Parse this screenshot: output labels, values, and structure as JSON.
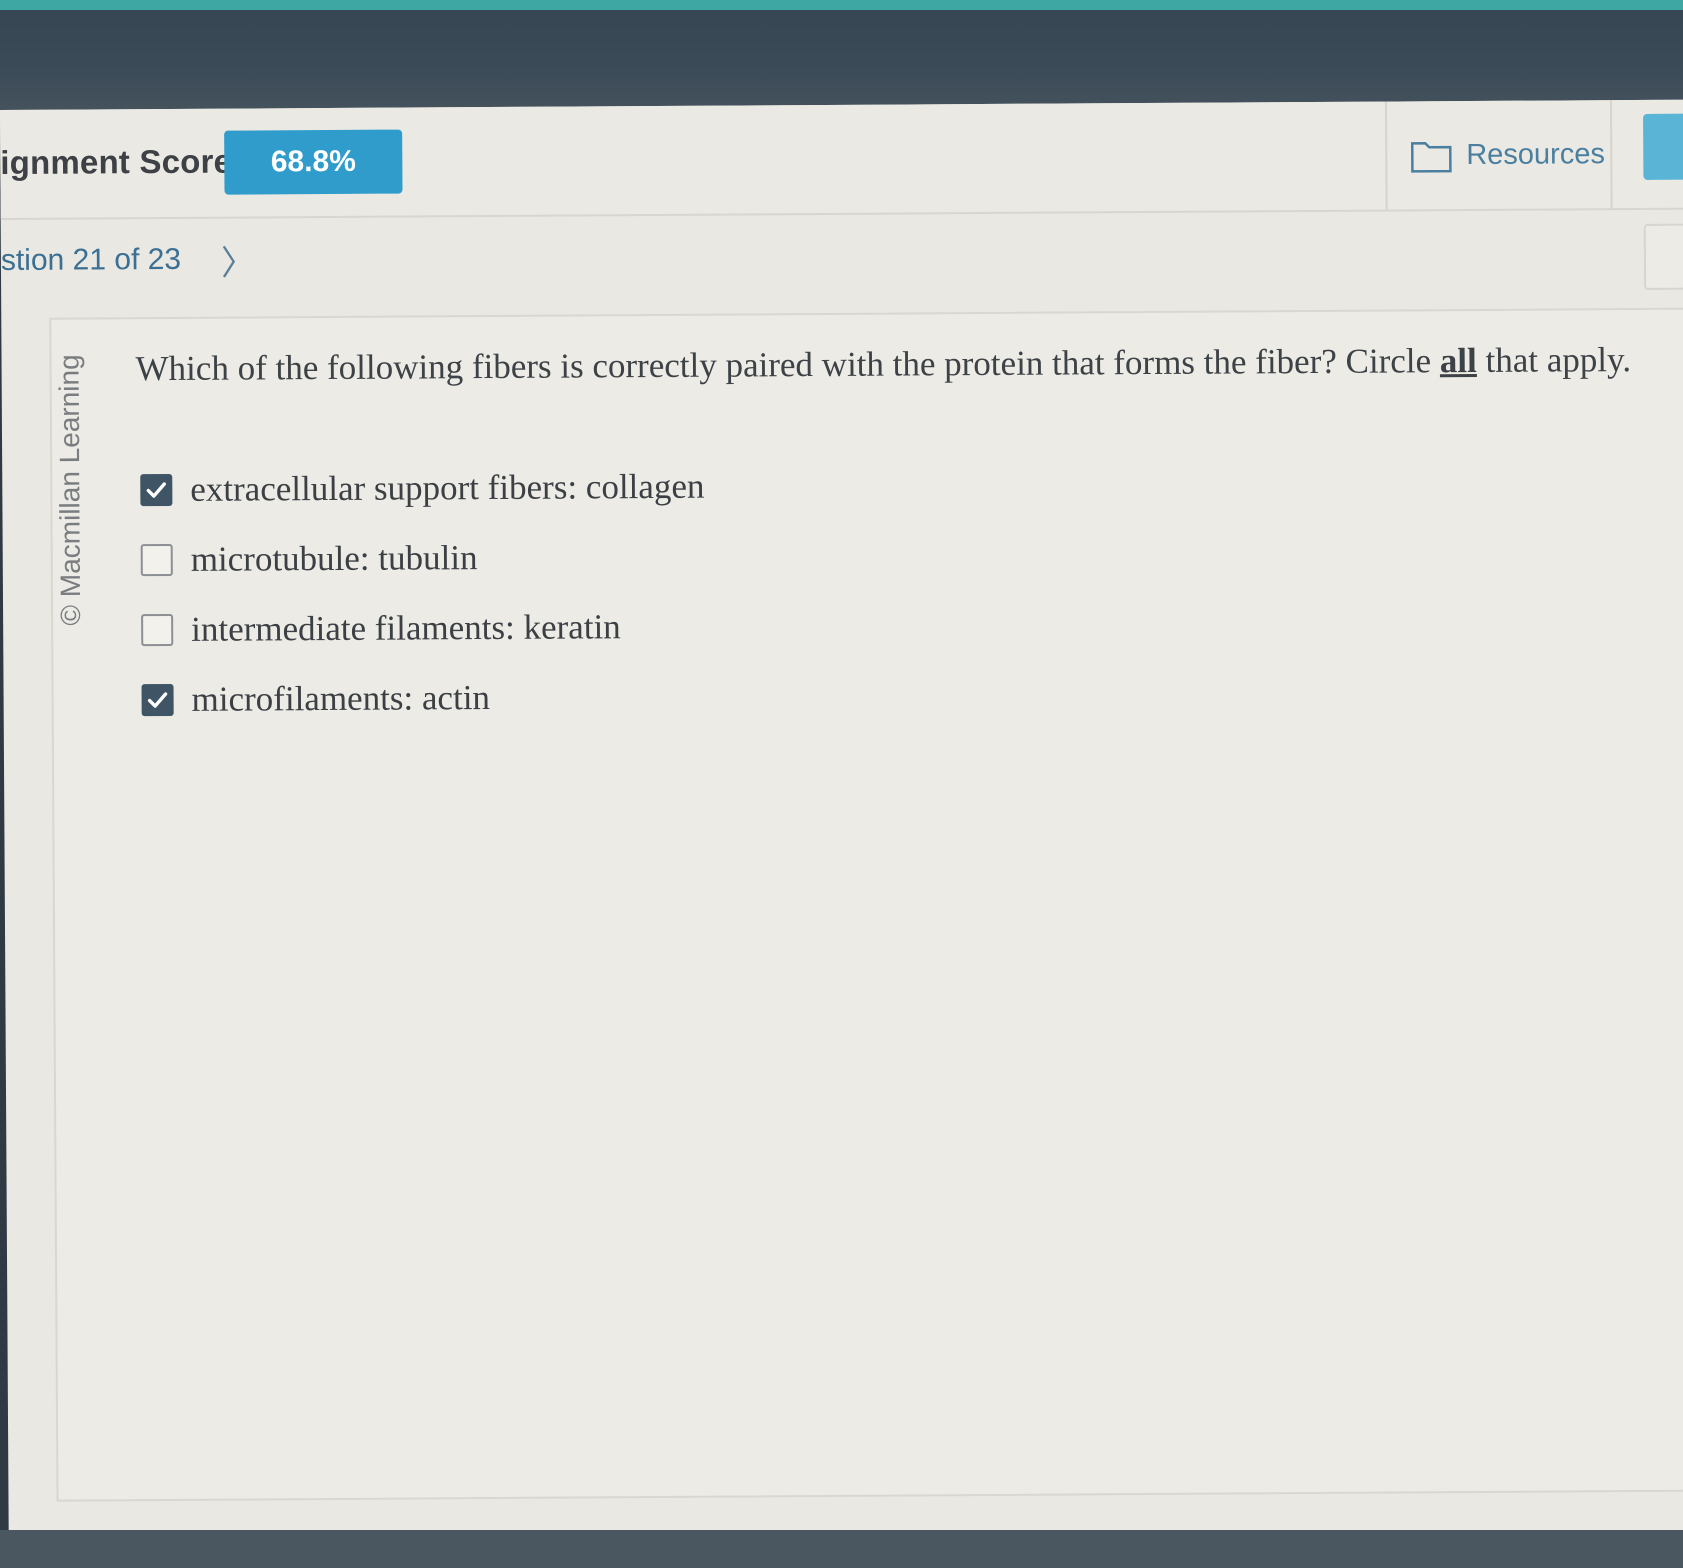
{
  "header": {
    "score_label": "ignment Score:",
    "score_value": "68.8%",
    "resources_label": "Resources"
  },
  "navigation": {
    "question_counter": "stion 21 of 23",
    "next_arrow": "〉"
  },
  "question": {
    "copyright": "© Macmillan Learning",
    "text_before": "Which of the following fibers is correctly paired with the protein that forms the fiber? Circle ",
    "text_emphasis": "all",
    "text_after": " that apply.",
    "options": [
      {
        "label": "extracellular support fibers:  collagen",
        "checked": true
      },
      {
        "label": "microtubule:  tubulin",
        "checked": false
      },
      {
        "label": "intermediate filaments:  keratin",
        "checked": false
      },
      {
        "label": "microfilaments:  actin",
        "checked": true
      }
    ]
  },
  "colors": {
    "score_badge": "#2f9ccc",
    "checkbox_checked": "#3f5566",
    "link": "#3b6f93"
  },
  "icons": {
    "resources": "folder-icon",
    "next": "chevron-right-icon",
    "check": "check-icon"
  }
}
